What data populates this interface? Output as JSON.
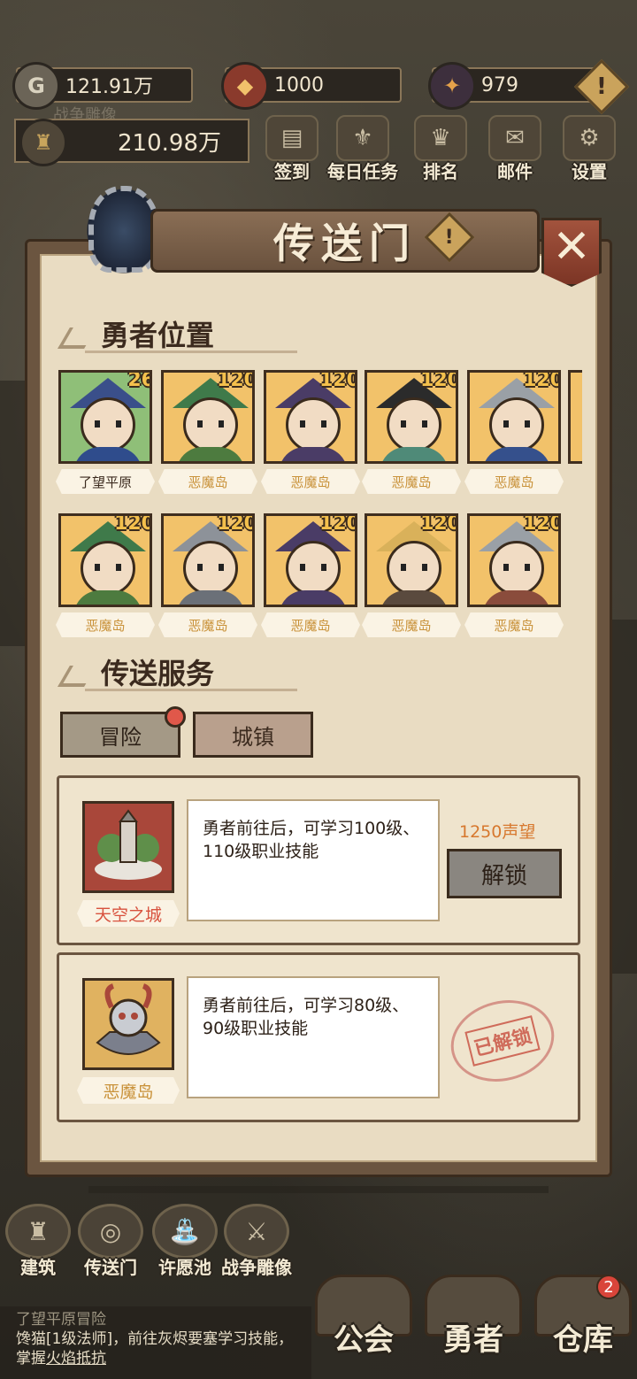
{
  "resources": {
    "gold": "121.91万",
    "honor": "1000",
    "crystal": "979"
  },
  "statue": {
    "label": "战争雕像",
    "value": "210.98万"
  },
  "top_menu": [
    {
      "label": "签到",
      "icon": "book-icon"
    },
    {
      "label": "每日任务",
      "icon": "fleur-icon"
    },
    {
      "label": "排名",
      "icon": "crown-icon"
    },
    {
      "label": "邮件",
      "icon": "mail-icon"
    },
    {
      "label": "设置",
      "icon": "gear-icon"
    }
  ],
  "dialog": {
    "title": "传送门",
    "hero_section": "勇者位置",
    "service_section": "传送服务"
  },
  "heroes": [
    {
      "level": "26",
      "location": "了望平原",
      "hat": "#3a4f8a",
      "body": "#2f4c8c",
      "bg": "green"
    },
    {
      "level": "120",
      "location": "恶魔岛",
      "hat": "#3f7a4a",
      "body": "#4d7b3f",
      "bg": "gold"
    },
    {
      "level": "120",
      "location": "恶魔岛",
      "hat": "#4a3c66",
      "body": "#4a3c66",
      "bg": "gold"
    },
    {
      "level": "120",
      "location": "恶魔岛",
      "hat": "#2b2b2b",
      "body": "#4f8a78",
      "bg": "gold"
    },
    {
      "level": "120",
      "location": "恶魔岛",
      "hat": "#9aa0a6",
      "body": "#35508c",
      "bg": "gold"
    },
    {
      "level": "120",
      "location": "恶魔岛",
      "hat": "#3f7a4a",
      "body": "#4d7b3f",
      "bg": "gold"
    },
    {
      "level": "120",
      "location": "恶魔岛",
      "hat": "#8d9299",
      "body": "#6b7078",
      "bg": "gold"
    },
    {
      "level": "120",
      "location": "恶魔岛",
      "hat": "#4a3c66",
      "body": "#4a3c66",
      "bg": "gold"
    },
    {
      "level": "120",
      "location": "恶魔岛",
      "hat": "#d9b15a",
      "body": "#5a4a3e",
      "bg": "gold"
    },
    {
      "level": "120",
      "location": "恶魔岛",
      "hat": "#9aa0a6",
      "body": "#8a4c3c",
      "bg": "gold"
    }
  ],
  "tabs": {
    "adventure": "冒险",
    "town": "城镇"
  },
  "services": [
    {
      "name": "天空之城",
      "desc": "勇者前往后，可学习100级、110级职业技能",
      "cost": "1250声望",
      "action": "解锁"
    },
    {
      "name": "恶魔岛",
      "desc": "勇者前往后，可学习80级、90级职业技能",
      "status": "已解锁"
    }
  ],
  "dock": [
    {
      "label": "建筑",
      "icon": "castle-icon"
    },
    {
      "label": "传送门",
      "icon": "portal-icon"
    },
    {
      "label": "许愿池",
      "icon": "fountain-icon"
    },
    {
      "label": "战争雕像",
      "icon": "statue-icon"
    }
  ],
  "log": {
    "line1": "了望平原冒险",
    "line2": "馋猫[1级法师]，前往灰烬要塞学习技能，掌握",
    "skill": "火焰抵抗"
  },
  "bottom_nav": {
    "guild": "公会",
    "heroes": "勇者",
    "warehouse": "仓库",
    "warehouse_badge": "2"
  }
}
